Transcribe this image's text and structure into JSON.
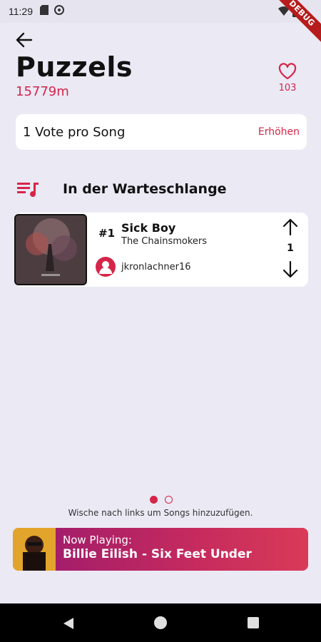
{
  "status_bar": {
    "time": "11:29",
    "debug_label": "DEBUG"
  },
  "header": {
    "title": "Puzzels",
    "distance": "15779m",
    "favorites_count": "103"
  },
  "vote_card": {
    "label": "1 Vote pro Song",
    "action": "Erhöhen"
  },
  "queue": {
    "heading": "In der Warteschlange",
    "items": [
      {
        "rank": "#1",
        "title": "Sick Boy",
        "artist": "The Chainsmokers",
        "user": "jkronlachner16",
        "votes": "1"
      }
    ]
  },
  "pager": {
    "pages": 2,
    "active_index": 0,
    "hint": "Wische nach links um Songs hinzuzufügen."
  },
  "now_playing": {
    "label": "Now Playing:",
    "song": "Billie Eilish - Six Feet Under"
  },
  "colors": {
    "accent": "#d6254a",
    "background": "#ebe9f4"
  }
}
